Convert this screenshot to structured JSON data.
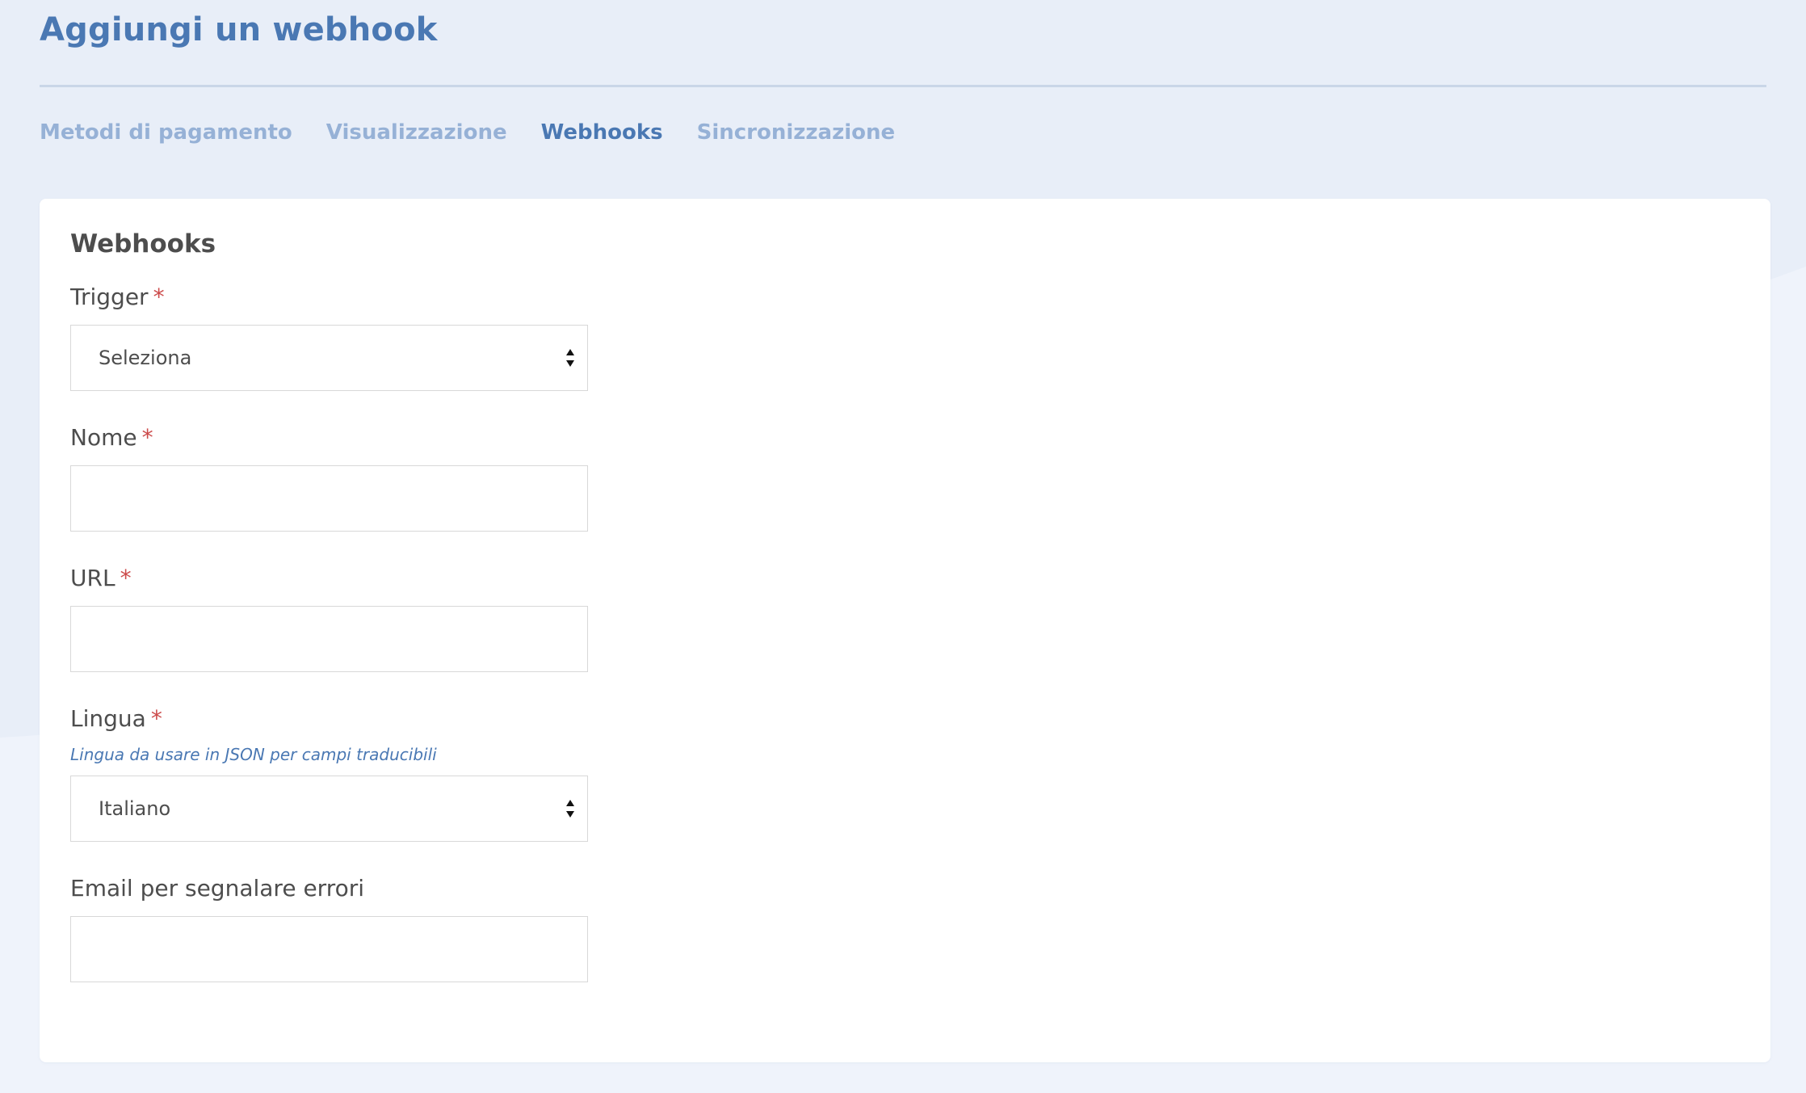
{
  "page": {
    "title": "Aggiungi un webhook"
  },
  "tabs": [
    {
      "label": "Metodi di pagamento",
      "active": false
    },
    {
      "label": "Visualizzazione",
      "active": false
    },
    {
      "label": "Webhooks",
      "active": true
    },
    {
      "label": "Sincronizzazione",
      "active": false
    }
  ],
  "card": {
    "title": "Webhooks",
    "fields": {
      "trigger": {
        "label": "Trigger",
        "required_mark": "*",
        "selected": "Seleziona"
      },
      "nome": {
        "label": "Nome",
        "required_mark": "*",
        "value": ""
      },
      "url": {
        "label": "URL",
        "required_mark": "*",
        "value": ""
      },
      "lingua": {
        "label": "Lingua",
        "required_mark": "*",
        "helper": "Lingua da usare in JSON per campi traducibili",
        "selected": "Italiano"
      },
      "email": {
        "label": "Email per segnalare errori",
        "value": ""
      }
    }
  },
  "colors": {
    "background": "#e8eef8",
    "accent": "#4a78b3",
    "tab_inactive": "#96b1d6",
    "required": "#cc4b4b"
  }
}
